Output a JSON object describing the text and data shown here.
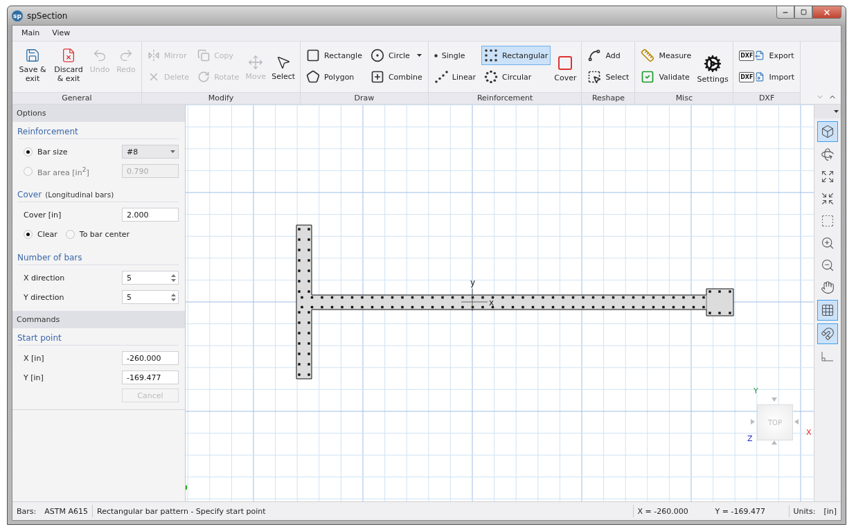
{
  "window": {
    "logo": "sp",
    "title": "spSection"
  },
  "menu": [
    {
      "label": "Main"
    },
    {
      "label": "View"
    }
  ],
  "ribbon": {
    "groups": [
      {
        "title": "General",
        "items": [
          {
            "label": "Save & exit",
            "kind": "large",
            "disabled": false
          },
          {
            "label": "Discard & exit",
            "kind": "large",
            "disabled": false
          },
          {
            "label": "Undo",
            "kind": "large",
            "disabled": true
          },
          {
            "label": "Redo",
            "kind": "large",
            "disabled": true
          }
        ]
      },
      {
        "title": "Modify",
        "items": [
          {
            "label": "Mirror",
            "kind": "small",
            "disabled": true
          },
          {
            "label": "Delete",
            "kind": "small",
            "disabled": true
          },
          {
            "label": "Copy",
            "kind": "small",
            "disabled": true
          },
          {
            "label": "Rotate",
            "kind": "small",
            "disabled": true
          },
          {
            "label": "Move",
            "kind": "large",
            "disabled": true
          },
          {
            "label": "Select",
            "kind": "large",
            "disabled": false
          }
        ]
      },
      {
        "title": "Draw",
        "items": [
          {
            "label": "Rectangle",
            "kind": "small",
            "disabled": false
          },
          {
            "label": "Polygon",
            "kind": "small",
            "disabled": false
          },
          {
            "label": "Circle",
            "kind": "small",
            "disabled": false,
            "dropdown": true
          },
          {
            "label": "Combine",
            "kind": "small",
            "disabled": false
          }
        ]
      },
      {
        "title": "Reinforcement",
        "items": [
          {
            "label": "Single",
            "kind": "small",
            "disabled": false,
            "selected": false
          },
          {
            "label": "Linear",
            "kind": "small",
            "disabled": false,
            "selected": false
          },
          {
            "label": "Rectangular",
            "kind": "small",
            "disabled": false,
            "selected": true
          },
          {
            "label": "Circular",
            "kind": "small",
            "disabled": false,
            "selected": false
          },
          {
            "label": "Cover",
            "kind": "large",
            "disabled": false,
            "selected": false
          }
        ]
      },
      {
        "title": "Reshape",
        "items": [
          {
            "label": "Add",
            "kind": "small",
            "disabled": false
          },
          {
            "label": "Select",
            "kind": "small",
            "disabled": false
          }
        ]
      },
      {
        "title": "Misc",
        "items": [
          {
            "label": "Measure",
            "kind": "small",
            "disabled": false
          },
          {
            "label": "Validate",
            "kind": "small",
            "disabled": false
          },
          {
            "label": "Settings",
            "kind": "large",
            "disabled": false
          }
        ]
      },
      {
        "title": "DXF",
        "items": [
          {
            "label": "Export",
            "kind": "small",
            "disabled": false,
            "badge": "DXF"
          },
          {
            "label": "Import",
            "kind": "small",
            "disabled": false,
            "badge": "DXF"
          }
        ]
      }
    ]
  },
  "options_panel": {
    "title": "Options",
    "sections": [
      {
        "title": "Reinforcement",
        "rows": [
          {
            "kind": "radio_select",
            "label": "Bar size",
            "selected": true,
            "value": "#8"
          },
          {
            "kind": "radio_field",
            "label": "Bar area [in$^{2}$]",
            "selected": false,
            "value": "0.790",
            "disabled": true
          }
        ]
      },
      {
        "title": "Cover",
        "subtitle": "(Longitudinal bars)",
        "rows": [
          {
            "kind": "field",
            "label": "Cover [in]",
            "value": "2.000"
          },
          {
            "kind": "radios",
            "options": [
              {
                "label": "Clear",
                "selected": true
              },
              {
                "label": "To bar center",
                "selected": false
              }
            ]
          }
        ]
      },
      {
        "title": "Number of bars",
        "rows": [
          {
            "kind": "spinner",
            "label": "X direction",
            "value": "5"
          },
          {
            "kind": "spinner",
            "label": "Y direction",
            "value": "5"
          }
        ]
      }
    ]
  },
  "commands_panel": {
    "title": "Commands",
    "sections": [
      {
        "title": "Start point",
        "rows": [
          {
            "kind": "field",
            "label": "X [in]",
            "value": "-260.000"
          },
          {
            "kind": "field",
            "label": "Y [in]",
            "value": "-169.477"
          }
        ]
      }
    ],
    "button": {
      "label": "Cancel",
      "disabled": true
    }
  },
  "canvas": {
    "origin_labels": {
      "x": "x",
      "y": "y"
    },
    "view_cube": {
      "face": "TOP",
      "x": "X",
      "y": "Y",
      "z": "Z"
    }
  },
  "view_toolbar": [
    {
      "selected": true
    },
    {
      "selected": false
    },
    {
      "selected": false
    },
    {
      "selected": false
    },
    {
      "selected": false
    },
    {
      "selected": false
    },
    {
      "selected": false
    },
    {
      "selected": false
    },
    {
      "selected": true
    },
    {
      "selected": true
    },
    {
      "selected": false
    }
  ],
  "status_bar": {
    "bars_label": "Bars:",
    "bars_value": "ASTM A615",
    "message": "Rectangular bar pattern - Specify start point",
    "x": "X = -260.000",
    "y": "Y = -169.477",
    "units_label": "Units:",
    "units_value": "[in]"
  }
}
